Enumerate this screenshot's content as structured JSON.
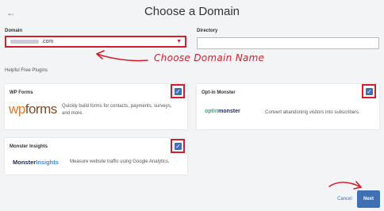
{
  "header": {
    "back_icon": "arrow-left-icon",
    "title": "Choose a Domain"
  },
  "domain": {
    "label": "Domain",
    "value": ".com",
    "dropdown_icon": "chevron-down-icon"
  },
  "directory": {
    "label": "Directory",
    "value": ""
  },
  "annotation": {
    "text": "Choose Domain Name",
    "color": "#d31f2c"
  },
  "plugins": {
    "heading": "Helpful Free Plugins",
    "items": [
      {
        "title": "WP Forms",
        "logo": {
          "part1": "wp",
          "part2": "forms"
        },
        "description": "Quickly build forms for contacts, payments, surveys, and more.",
        "checked": true
      },
      {
        "title": "Opt-in Monster",
        "logo": {
          "part1": "optin",
          "part2": "monster"
        },
        "description": "Convert abandoning visitors into subscribers.",
        "checked": true
      },
      {
        "title": "Monster Insights",
        "logo": {
          "part1": "Monster",
          "part2": "Insights"
        },
        "description": "Measure website traffic using Google Analytics.",
        "checked": true
      }
    ]
  },
  "footer": {
    "cancel_label": "Cancel",
    "next_label": "Next"
  },
  "colors": {
    "accent": "#3f70b3",
    "annotation": "#d31f2c",
    "background": "#f3f4f6"
  }
}
